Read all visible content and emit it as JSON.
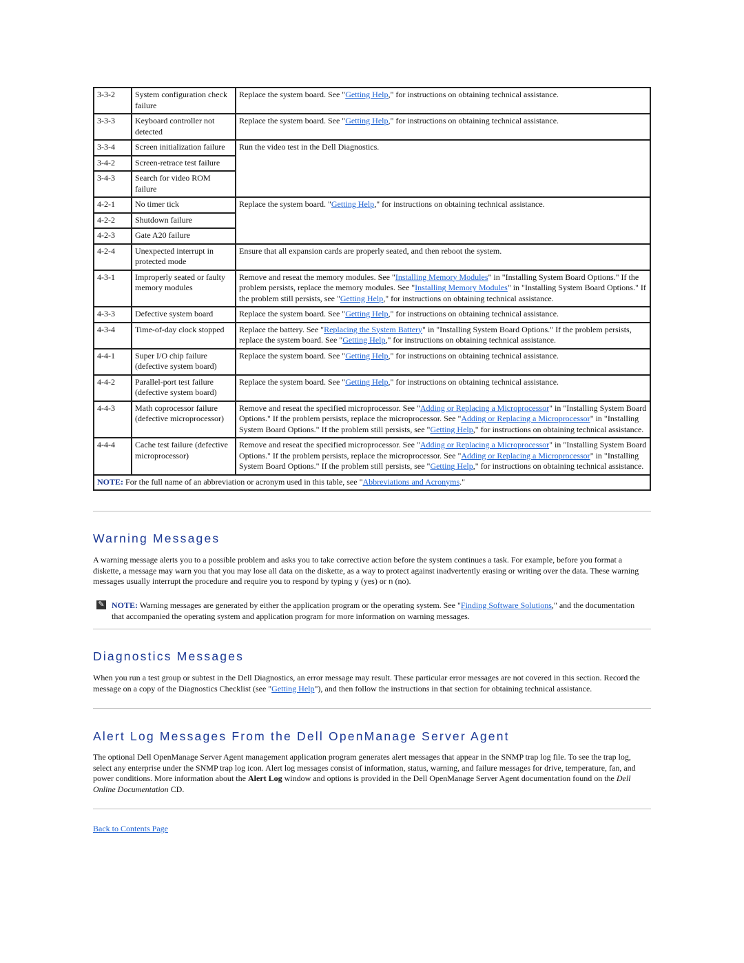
{
  "table": {
    "rows": [
      {
        "code": "3-3-2",
        "problem": "System configuration check failure",
        "action": [
          {
            "t": "Replace the system board. See \""
          },
          {
            "t": "Getting Help",
            "link": true
          },
          {
            "t": ",\" for instructions on obtaining technical assistance."
          }
        ],
        "span": 1
      },
      {
        "code": "3-3-3",
        "problem": "Keyboard controller not detected",
        "action": [
          {
            "t": "Replace the system board. See \""
          },
          {
            "t": "Getting Help",
            "link": true
          },
          {
            "t": ",\" for instructions on obtaining technical assistance."
          }
        ],
        "span": 1
      },
      {
        "code": "3-3-4",
        "problem": "Screen initialization failure",
        "action": [
          {
            "t": "Run the video test in the Dell Diagnostics."
          }
        ],
        "span": 3
      },
      {
        "code": "3-4-2",
        "problem": "Screen-retrace test failure"
      },
      {
        "code": "3-4-3",
        "problem": "Search for video ROM failure"
      },
      {
        "code": "4-2-1",
        "problem": "No timer tick",
        "action": [
          {
            "t": "Replace the system board. \""
          },
          {
            "t": "Getting Help",
            "link": true
          },
          {
            "t": ",\" for instructions on obtaining technical assistance."
          }
        ],
        "span": 3
      },
      {
        "code": "4-2-2",
        "problem": "Shutdown failure"
      },
      {
        "code": "4-2-3",
        "problem": "Gate A20 failure"
      },
      {
        "code": "4-2-4",
        "problem": "Unexpected interrupt in protected mode",
        "action": [
          {
            "t": "Ensure that all expansion cards are properly seated, and then reboot the system."
          }
        ],
        "span": 1
      },
      {
        "code": "4-3-1",
        "problem": "Improperly seated or faulty memory modules",
        "action": [
          {
            "t": "Remove and reseat the memory modules. See \""
          },
          {
            "t": "Installing Memory Modules",
            "link": true
          },
          {
            "t": "\" in \"Installing System Board Options.\" If the problem persists, replace the memory modules. See \""
          },
          {
            "t": "Installing Memory Modules",
            "link": true
          },
          {
            "t": "\" in \"Installing System Board Options.\" If the problem still persists, see \""
          },
          {
            "t": "Getting Help",
            "link": true
          },
          {
            "t": ",\" for instructions on obtaining technical assistance."
          }
        ],
        "span": 1
      },
      {
        "code": "4-3-3",
        "problem": "Defective system board",
        "action": [
          {
            "t": "Replace the system board. See \""
          },
          {
            "t": "Getting Help",
            "link": true
          },
          {
            "t": ",\" for instructions on obtaining technical assistance."
          }
        ],
        "span": 1
      },
      {
        "code": "4-3-4",
        "problem": "Time-of-day clock stopped",
        "action": [
          {
            "t": "Replace the battery. See \""
          },
          {
            "t": "Replacing the System Battery",
            "link": true
          },
          {
            "t": "\" in \"Installing System Board Options.\" If the problem persists, replace the system board. See \""
          },
          {
            "t": "Getting Help",
            "link": true
          },
          {
            "t": ",\" for instructions on obtaining technical assistance."
          }
        ],
        "span": 1
      },
      {
        "code": "4-4-1",
        "problem": "Super I/O chip failure (defective system board)",
        "action": [
          {
            "t": "Replace the system board. See \""
          },
          {
            "t": "Getting Help",
            "link": true
          },
          {
            "t": ",\" for instructions on obtaining technical assistance."
          }
        ],
        "span": 1
      },
      {
        "code": "4-4-2",
        "problem": "Parallel-port test failure (defective system board)",
        "action": [
          {
            "t": "Replace the system board. See \""
          },
          {
            "t": "Getting Help",
            "link": true
          },
          {
            "t": ",\" for instructions on obtaining technical assistance."
          }
        ],
        "span": 1
      },
      {
        "code": "4-4-3",
        "problem": "Math coprocessor failure (defective microprocessor)",
        "action": [
          {
            "t": "Remove and reseat the specified microprocessor. See \""
          },
          {
            "t": "Adding or Replacing a Microprocessor",
            "link": true
          },
          {
            "t": "\" in \"Installing System Board Options.\" If the problem persists, replace the microprocessor. See \""
          },
          {
            "t": "Adding or Replacing a Microprocessor",
            "link": true
          },
          {
            "t": "\" in \"Installing System Board Options.\" If the problem still persists, see \""
          },
          {
            "t": "Getting Help",
            "link": true
          },
          {
            "t": ",\" for instructions on obtaining technical assistance."
          }
        ],
        "span": 1
      },
      {
        "code": "4-4-4",
        "problem": "Cache test failure (defective microprocessor)",
        "action": [
          {
            "t": "Remove and reseat the specified microprocessor. See \""
          },
          {
            "t": "Adding or Replacing a Microprocessor",
            "link": true
          },
          {
            "t": "\" in \"Installing System Board Options.\" If the problem persists, replace the microprocessor. See \""
          },
          {
            "t": "Adding or Replacing a Microprocessor",
            "link": true
          },
          {
            "t": "\" in \"Installing System Board Options.\" If the problem still persists, see \""
          },
          {
            "t": "Getting Help",
            "link": true
          },
          {
            "t": ",\" for instructions on obtaining technical assistance."
          }
        ],
        "span": 1
      }
    ],
    "note": [
      {
        "t": "NOTE:",
        "bold": true
      },
      {
        "t": " For the full name of an abbreviation or acronym used in this table, see \""
      },
      {
        "t": "Abbreviations and Acronyms",
        "link": true
      },
      {
        "t": ".\""
      }
    ]
  },
  "warning": {
    "title": "Warning Messages",
    "body": [
      {
        "t": "A warning message alerts you to a possible problem and asks you to take corrective action before the system continues a task. For example, before you format a diskette, a message may warn you that you may lose all data on the diskette, as a way to protect against inadvertently erasing or writing over the data. These warning messages usually interrupt the procedure and require you to respond by typing "
      },
      {
        "t": "y",
        "code": true
      },
      {
        "t": " (yes) or "
      },
      {
        "t": "n",
        "code": true
      },
      {
        "t": " (no)."
      }
    ],
    "note": [
      {
        "t": "NOTE:",
        "bold": true
      },
      {
        "t": " Warning messages are generated by either the application program or the operating system. See \""
      },
      {
        "t": "Finding Software Solutions",
        "link": true
      },
      {
        "t": ",\" and the documentation that accompanied the operating system and application program for more information on warning messages."
      }
    ]
  },
  "diagnostics": {
    "title": "Diagnostics Messages",
    "body": [
      {
        "t": "When you run a test group or subtest in the Dell Diagnostics, an error message may result. These particular error messages are not covered in this section. Record the message on a copy of the Diagnostics Checklist (see \""
      },
      {
        "t": "Getting Help",
        "link": true
      },
      {
        "t": "\"), and then follow the instructions in that section for obtaining technical assistance."
      }
    ]
  },
  "alertlog": {
    "title": "Alert Log Messages From the Dell OpenManage Server Agent",
    "body": [
      {
        "t": "The optional Dell OpenManage Server Agent management application program generates alert messages that appear in the SNMP trap log file. To see the trap log, select any enterprise under the SNMP trap log icon. Alert log messages consist of information, status, warning, and failure messages for drive, temperature, fan, and power conditions. More information about the "
      },
      {
        "t": "Alert Log",
        "strong": true
      },
      {
        "t": " window and options is provided in the Dell OpenManage Server Agent documentation found on the "
      },
      {
        "t": "Dell Online Documentation",
        "em": true
      },
      {
        "t": " CD."
      }
    ]
  },
  "back_link": "Back to Contents Page",
  "colors": {
    "link": "#1a5fd1",
    "heading": "#1d3a95"
  }
}
